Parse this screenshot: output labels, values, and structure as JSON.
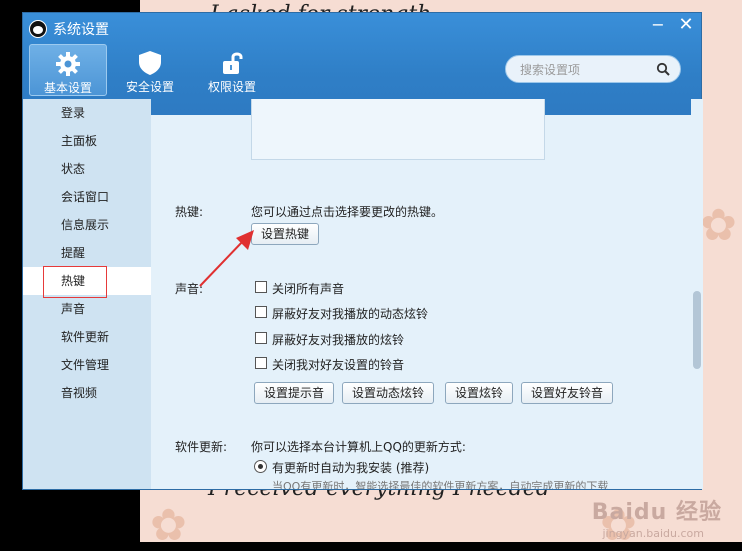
{
  "window": {
    "title": "系统设置"
  },
  "toolbar": {
    "basic": "基本设置",
    "security": "安全设置",
    "permission": "权限设置",
    "search_placeholder": "搜索设置项"
  },
  "sidebar": {
    "items": [
      {
        "label": "登录"
      },
      {
        "label": "主面板"
      },
      {
        "label": "状态"
      },
      {
        "label": "会话窗口"
      },
      {
        "label": "信息展示"
      },
      {
        "label": "提醒"
      },
      {
        "label": "热键",
        "selected": true
      },
      {
        "label": "声音"
      },
      {
        "label": "软件更新"
      },
      {
        "label": "文件管理"
      },
      {
        "label": "音视频"
      }
    ]
  },
  "hotkey": {
    "label": "热键:",
    "desc": "您可以通过点击选择要更改的热键。",
    "button": "设置热键"
  },
  "sound": {
    "label": "声音:",
    "options": [
      {
        "label": "关闭所有声音",
        "checked": false
      },
      {
        "label": "屏蔽好友对我播放的动态炫铃",
        "checked": false
      },
      {
        "label": "屏蔽好友对我播放的炫铃",
        "checked": false
      },
      {
        "label": "关闭我对好友设置的铃音",
        "checked": false
      }
    ],
    "buttons": [
      "设置提示音",
      "设置动态炫铃",
      "设置炫铃",
      "设置好友铃音"
    ]
  },
  "update": {
    "label": "软件更新:",
    "desc": "你可以选择本台计算机上QQ的更新方式:",
    "option": "有更新时自动为我安装 (推荐)",
    "hint": "当QQ有更新时，智能选择最佳的软件更新方案，自动完成更新的下载"
  },
  "background": {
    "top_text": "I asked for strength",
    "bottom_text": "I received everything I needed",
    "watermark": "Baidu 经验",
    "watermark_sub": "jingyan.baidu.com"
  },
  "colors": {
    "accent": "#2f7fc7",
    "highlight": "#e63a3a"
  }
}
